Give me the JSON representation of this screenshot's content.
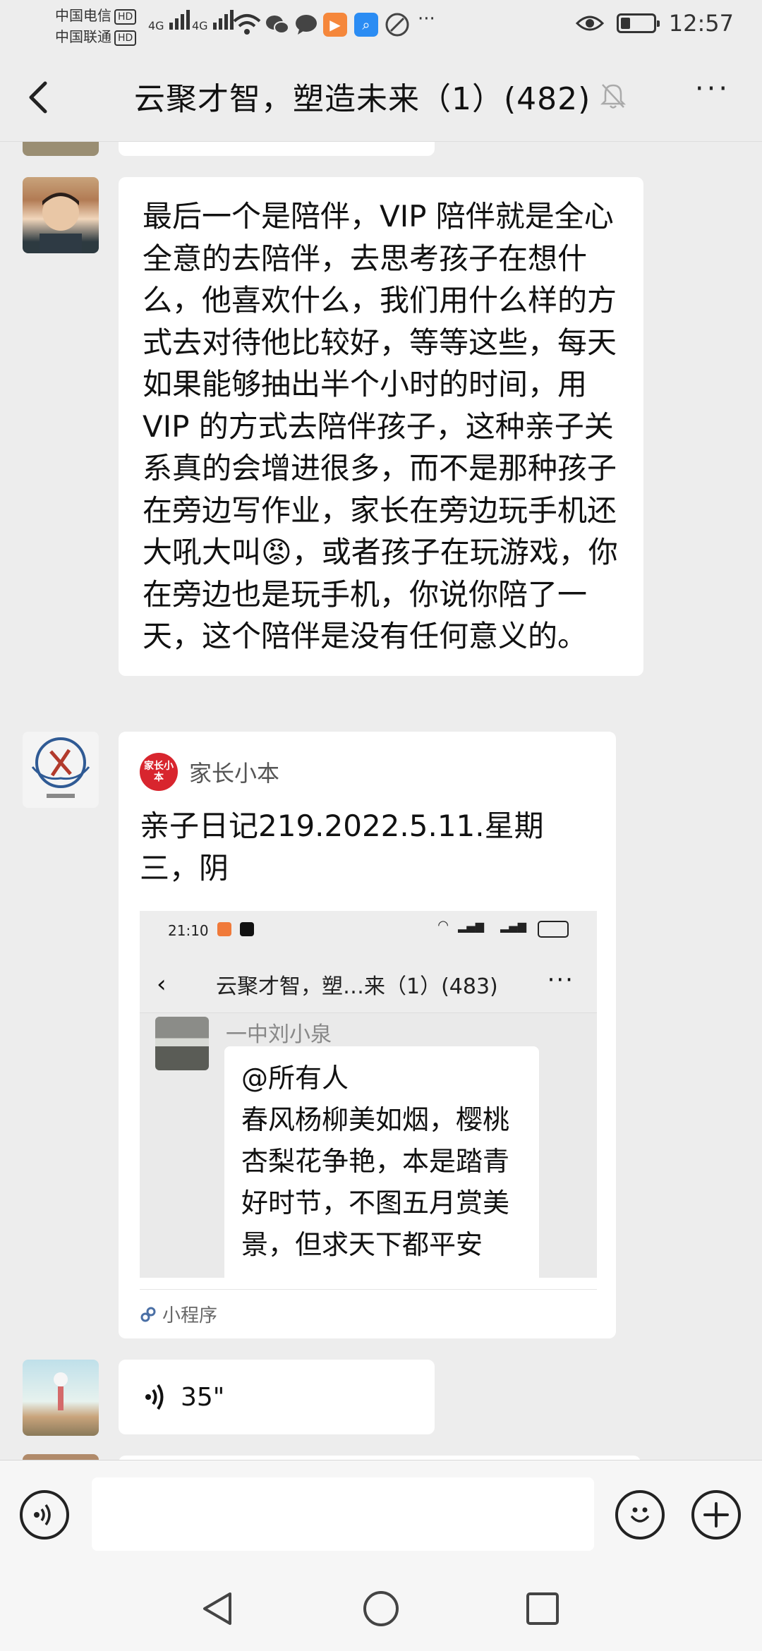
{
  "status_bar": {
    "carrier1": "中国电信",
    "carrier2": "中国联通",
    "hd_badge": "HD",
    "net1": "4G",
    "net2": "4G",
    "time": "12:57",
    "battery_level": 0.3,
    "icons": [
      "signal-icon",
      "wifi-icon",
      "wechat-icon",
      "message-icon",
      "video-app-icon",
      "search-app-icon",
      "browser-icon",
      "more-dots-icon",
      "eye-icon",
      "battery-icon"
    ]
  },
  "header": {
    "title": "云聚才智，塑造未来（1）(482)",
    "back_icon": "back-chevron-icon",
    "mute_icon": "bell-muted-icon",
    "more_label": "···"
  },
  "messages": {
    "text_message": {
      "content": "最后一个是陪伴，VIP 陪伴就是全心全意的去陪伴，去思考孩子在想什么，他喜欢什么，我们用什么样的方式去对待他比较好，等等这些，每天如果能够抽出半个小时的时间，用 VIP 的方式去陪伴孩子，这种亲子关系真的会增进很多，而不是那种孩子在旁边写作业，家长在旁边玩手机还大吼大叫😡，或者孩子在玩游戏，你在旁边也是玩手机，你说你陪了一天，这个陪伴是没有任何意义的。"
    },
    "mini_program": {
      "brand_logo_text": "家长小本",
      "brand_name": "家长小本",
      "title": "亲子日记219.2022.5.11.星期三，阴",
      "footer_label": "小程序",
      "screenshot": {
        "time": "21:10",
        "title": "云聚才智，塑…来（1）(483)",
        "more": "···",
        "sender_name": "一中刘小泉",
        "message": "@所有人\n春风杨柳美如烟，樱桃杏梨花争艳，本是踏青好时节，不图五月赏美景，但求天下都平安"
      }
    },
    "voice_message": {
      "duration": "35\""
    }
  },
  "input_bar": {
    "placeholder": "",
    "voice_icon": "voice-input-icon",
    "emoji_icon": "emoji-icon",
    "plus_icon": "plus-icon"
  },
  "nav_bar": {
    "icons": [
      "nav-back-icon",
      "nav-home-icon",
      "nav-recents-icon"
    ]
  }
}
